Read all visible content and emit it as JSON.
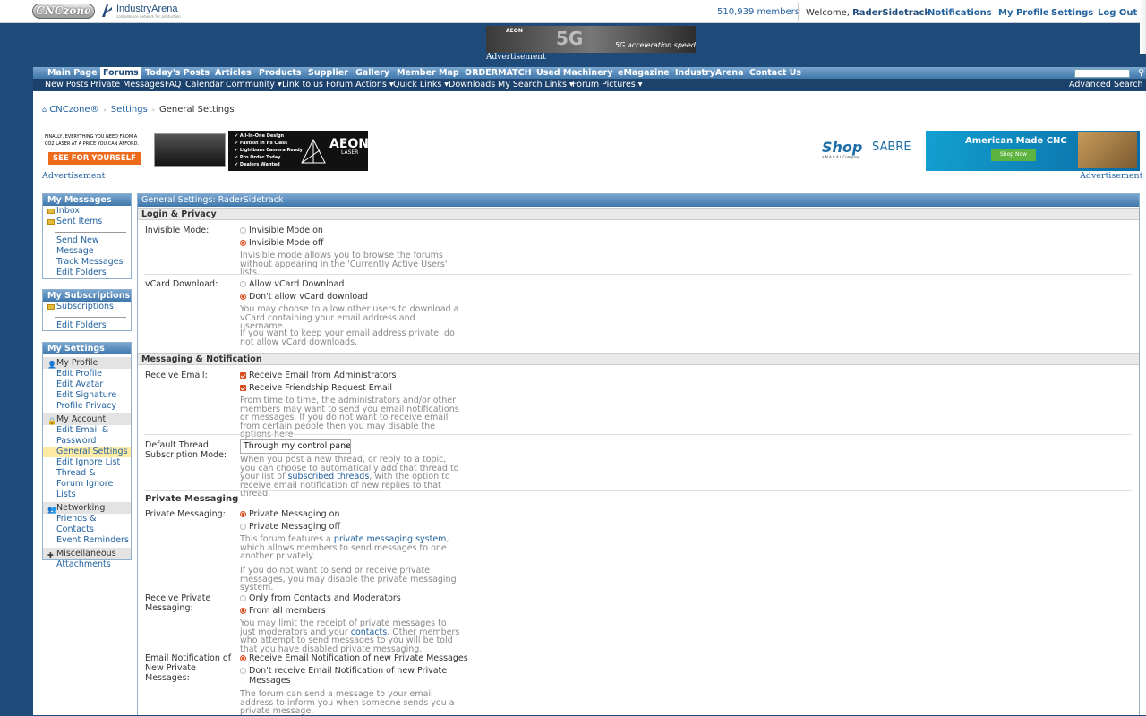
{
  "header": {
    "cnc_logo": "CNCzone",
    "ia_name": "IndustryArena",
    "ia_tag": "competence network for production",
    "members": "510,939 members",
    "welcome_label": "Welcome,",
    "username": "RaderSidetrack",
    "notifications": "Notifications",
    "my_profile": "My Profile",
    "settings": "Settings",
    "logout": "Log Out"
  },
  "top_ad": {
    "brand": "AEON",
    "big": "5G",
    "tagline": "5G acceleration speed",
    "label": "Advertisement"
  },
  "nav_primary": [
    "Main Page",
    "Forums",
    "Today's Posts",
    "Articles",
    "Products",
    "Supplier",
    "Gallery",
    "Member Map",
    "ORDERMATCH",
    "Used Machinery",
    "eMagazine",
    "IndustryArena",
    "Contact Us"
  ],
  "nav_secondary": [
    "New Posts",
    "Private Messages",
    "FAQ",
    "Calendar",
    "Community ▾",
    "Link to us",
    "Forum Actions ▾",
    "Quick Links ▾",
    "Downloads",
    "My Search Links ▾",
    "Forum Pictures ▾"
  ],
  "advanced_search": "Advanced Search",
  "breadcrumb": {
    "home": "CNCzone®",
    "settings": "Settings",
    "current": "General Settings"
  },
  "ad_left": {
    "line1": "FINALLY, EVERYTHING YOU NEED FROM A",
    "line2": "CO2 LASER AT A PRICE YOU CAN AFFORD.",
    "cta": "SEE FOR YOURSELF",
    "features": [
      "✔ All-In-One Design",
      "✔ Fastest In Its Class",
      "✔ Lightburn Camera Ready",
      "✔ Pro Order Today",
      "✔ Dealers Wanted"
    ],
    "logo": "AEON",
    "logo_sub": "LASER",
    "label": "Advertisement"
  },
  "ad_right": {
    "shop": "Shop",
    "sabre": "SABRE",
    "nacal": "a N.A.C.A.L Company",
    "headline": "American Made CNC",
    "button": "Shop Now",
    "label": "Advertisement"
  },
  "sidebar": {
    "messages": {
      "title": "My Messages",
      "folders": [
        "Inbox",
        "Sent Items"
      ],
      "links": [
        "Send New Message",
        "Track Messages",
        "Edit Folders"
      ]
    },
    "subscriptions": {
      "title": "My Subscriptions",
      "folders": [
        "Subscriptions"
      ],
      "links": [
        "Edit Folders"
      ]
    },
    "settings": {
      "title": "My Settings",
      "profile_group": "My Profile",
      "profile_links": [
        "Edit Profile",
        "Edit Avatar",
        "Edit Signature",
        "Profile Privacy"
      ],
      "account_group": "My Account",
      "account_links": [
        "Edit Email & Password",
        "General Settings",
        "Edit Ignore List",
        "Thread & Forum Ignore Lists"
      ],
      "networking_group": "Networking",
      "networking_links": [
        "Friends & Contacts",
        "Event Reminders"
      ],
      "misc_group": "Miscellaneous",
      "misc_links": [
        "Attachments"
      ]
    }
  },
  "panel": {
    "title": "General Settings: RaderSidetrack",
    "login_privacy": {
      "title": "Login & Privacy",
      "invisible": {
        "label": "Invisible Mode:",
        "options": [
          "Invisible Mode on",
          "Invisible Mode off"
        ],
        "selected": 1,
        "desc": "Invisible mode allows you to browse the forums without appearing in the 'Currently Active Users' lists."
      },
      "vcard": {
        "label": "vCard Download:",
        "options": [
          "Allow vCard Download",
          "Don't allow vCard download"
        ],
        "selected": 1,
        "desc1": "You may choose to allow other users to download a vCard containing your email address and username.",
        "desc2": "If you want to keep your email address private, do not allow vCard downloads."
      }
    },
    "messaging": {
      "title": "Messaging & Notification",
      "receive_email": {
        "label": "Receive Email:",
        "options": [
          "Receive Email from Administrators",
          "Receive Friendship Request Email"
        ],
        "desc": "From time to time, the administrators and/or other members may want to send you email notifications or messages. If you do not want to receive email from certain people then you may disable the options here"
      },
      "thread_sub": {
        "label": "Default Thread Subscription Mode:",
        "value": "Through my control panel only",
        "desc_pre": "When you post a new thread, or reply to a topic, you can choose to automatically add that thread to your list of",
        "desc_link": "subscribed threads",
        "desc_post": ", with the option to receive email notification of new replies to that thread."
      },
      "pm_title": "Private Messaging",
      "pm": {
        "label": "Private Messaging:",
        "options": [
          "Private Messaging on",
          "Private Messaging off"
        ],
        "selected": 0,
        "desc_pre": "This forum features a",
        "desc_link": "private messaging system",
        "desc_post": ", which allows members to send messages to one another privately.",
        "desc2": "If you do not want to send or receive private messages, you may disable the private messaging system."
      },
      "receive_pm": {
        "label": "Receive Private Messaging:",
        "options": [
          "Only from Contacts and Moderators",
          "From all members"
        ],
        "selected": 1,
        "desc_pre": "You may limit the receipt of private messages to just moderators and your",
        "desc_link": "contacts",
        "desc_post": ". Other members who attempt to send messages to you will be told that you have disabled private messaging."
      },
      "email_pm": {
        "label": "Email Notification of New Private Messages:",
        "options": [
          "Receive Email Notification of new Private Messages",
          "Don't receive Email Notification of new Private Messages"
        ],
        "selected": 0,
        "desc": "The forum can send a message to your email address to inform you when someone sends you a private message."
      }
    }
  },
  "colors": {
    "page_bg": "#1f4b7a",
    "nav_gradient_top": "#7aa6cf",
    "nav_gradient_bottom": "#3f77ab",
    "link": "#22629f",
    "radio_selected": "#d84a1a",
    "active_item": "#ffeaa2"
  }
}
